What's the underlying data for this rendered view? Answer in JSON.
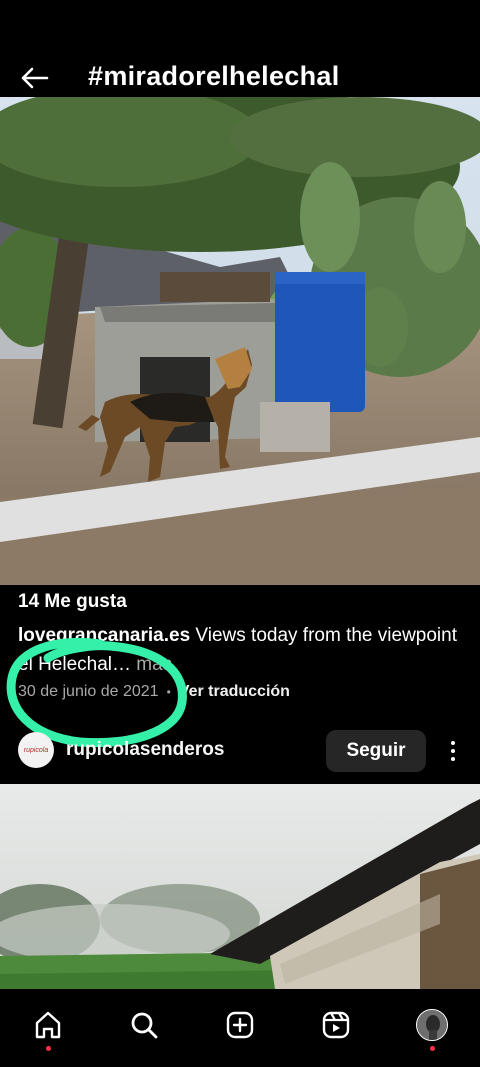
{
  "header": {
    "title": "#miradorelhelechal",
    "back_icon": "arrow-left-icon"
  },
  "post": {
    "image_subject": "german-shepherd-dog-photo",
    "likes": "14 Me gusta",
    "username": "lovegrancanaria.es",
    "caption_text": " Views today from the viewpoint el Helechal",
    "caption_ellipsis": "… ",
    "more_label": "más",
    "date": "30 de junio de 2021",
    "separator": "•",
    "translate_label": "Ver traducción",
    "annotation_color": "#35f0a8"
  },
  "suggested": {
    "avatar_text": "rupicola",
    "username": "rupicolasenderos",
    "follow_label": "Seguir"
  },
  "bottom_nav": {
    "items": [
      "home-icon",
      "search-icon",
      "create-icon",
      "reels-icon",
      "profile-avatar"
    ],
    "notification_color": "#ff3040"
  }
}
